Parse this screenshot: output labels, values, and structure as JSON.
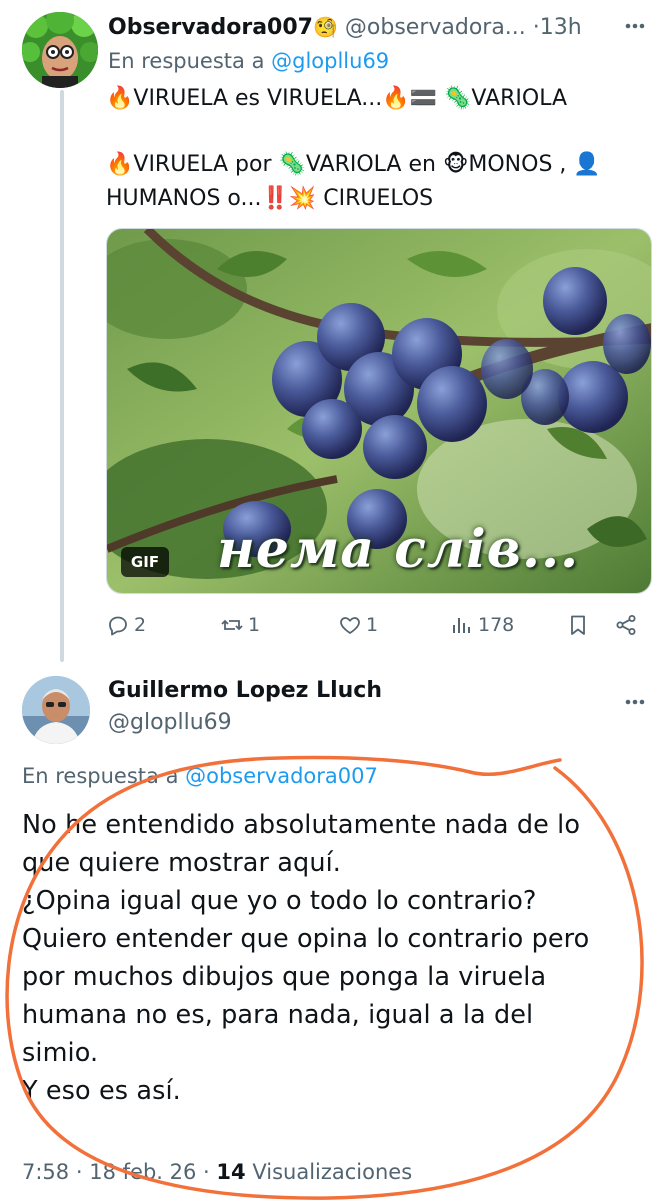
{
  "tweet1": {
    "author_name": "Observadora007",
    "author_emoji": "🧐",
    "handle": "@observadora...",
    "separator": "·",
    "time": "13h",
    "reply_prefix": "En respuesta a",
    "reply_handle": "@glopllu69",
    "text_lines": [
      "🔥VIRUELA es VIRUELA...🔥🟰 🦠VARIOLA",
      "🔥VIRUELA por 🦠VARIOLA en 🐵MONOS , 👤",
      "HUMANOS o...‼️💥 CIRUELOS"
    ],
    "media": {
      "badge": "GIF",
      "caption": "нема слів..."
    },
    "stats": {
      "replies": "2",
      "reposts": "1",
      "likes": "1",
      "views": "178"
    }
  },
  "tweet2": {
    "author_name": "Guillermo Lopez Lluch",
    "handle": "@glopllu69",
    "reply_prefix": "En respuesta a",
    "reply_handle": "@observadora007",
    "text_lines": [
      "No he entendido absolutamente  nada de lo",
      "que quiere mostrar aquí.",
      "¿Opina igual que yo o todo lo contrario?",
      "Quiero entender que opina lo contrario pero",
      "por muchos dibujos que ponga la viruela",
      "humana no es, para nada, igual a la del",
      "simio.",
      "Y eso es así."
    ],
    "time": "7:58",
    "separator": "·",
    "date": "18 feb. 26",
    "separator2": "·",
    "view_count": "14",
    "view_label": "Visualizaciones"
  },
  "colors": {
    "text": "#0f1419",
    "secondary": "#536471",
    "link": "#1d9bf0",
    "annotation": "#f2703a"
  }
}
